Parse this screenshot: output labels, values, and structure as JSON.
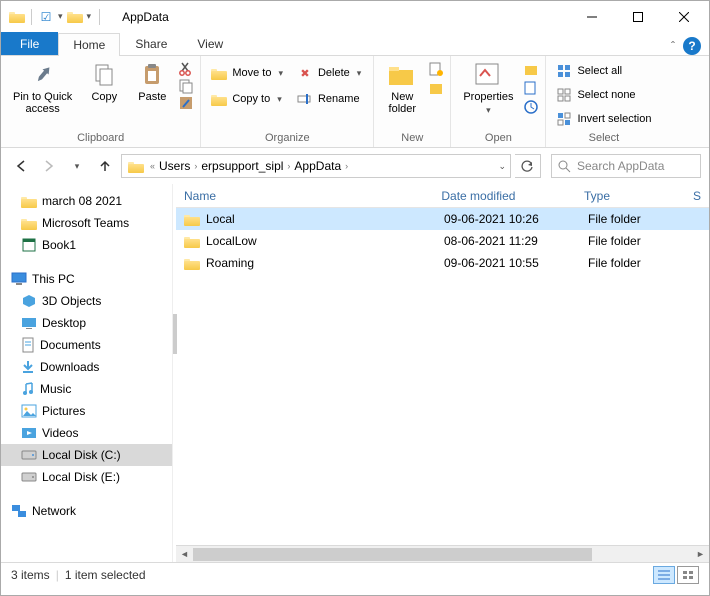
{
  "window": {
    "title": "AppData"
  },
  "tabs": {
    "file": "File",
    "home": "Home",
    "share": "Share",
    "view": "View"
  },
  "ribbon": {
    "clipboard": {
      "label": "Clipboard",
      "pin": "Pin to Quick\naccess",
      "copy": "Copy",
      "paste": "Paste"
    },
    "organize": {
      "label": "Organize",
      "move": "Move to",
      "copy": "Copy to",
      "delete": "Delete",
      "rename": "Rename"
    },
    "new": {
      "label": "New",
      "folder": "New\nfolder"
    },
    "open": {
      "label": "Open",
      "properties": "Properties"
    },
    "select": {
      "label": "Select",
      "all": "Select all",
      "none": "Select none",
      "invert": "Invert selection"
    }
  },
  "breadcrumb": [
    "Users",
    "erpsupport_sipl",
    "AppData"
  ],
  "search_placeholder": "Search AppData",
  "tree": {
    "quick": [
      "march 08 2021",
      "Microsoft Teams",
      "Book1"
    ],
    "thispc": "This PC",
    "drives": [
      "3D Objects",
      "Desktop",
      "Documents",
      "Downloads",
      "Music",
      "Pictures",
      "Videos",
      "Local Disk (C:)",
      "Local Disk (E:)"
    ],
    "network": "Network"
  },
  "columns": {
    "name": "Name",
    "date": "Date modified",
    "type": "Type",
    "size": "S"
  },
  "column_widths": {
    "name": 260,
    "date": 144,
    "type": 110
  },
  "rows": [
    {
      "name": "Local",
      "date": "09-06-2021 10:26",
      "type": "File folder",
      "selected": true
    },
    {
      "name": "LocalLow",
      "date": "08-06-2021 11:29",
      "type": "File folder",
      "selected": false
    },
    {
      "name": "Roaming",
      "date": "09-06-2021 10:55",
      "type": "File folder",
      "selected": false
    }
  ],
  "status": {
    "count": "3 items",
    "selection": "1 item selected"
  }
}
